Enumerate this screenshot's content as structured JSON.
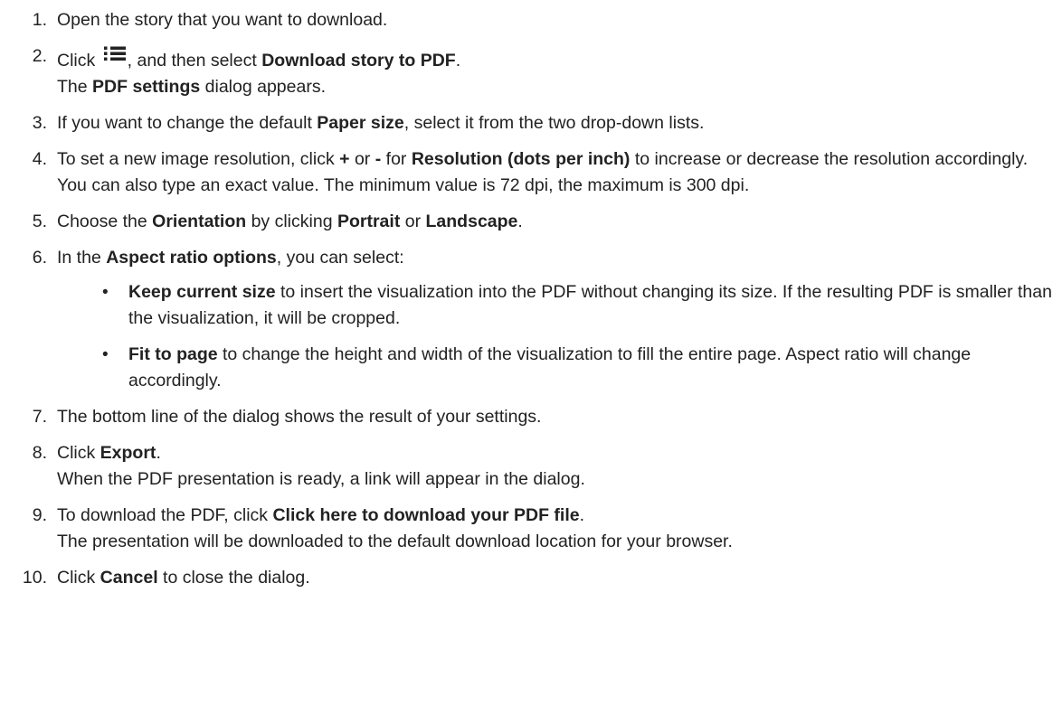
{
  "steps": [
    {
      "num": "1.",
      "parts": [
        {
          "t": "Open the story that you want to download."
        }
      ]
    },
    {
      "num": "2.",
      "parts": [
        {
          "t": "Click "
        },
        {
          "icon": "menu-list-icon"
        },
        {
          "t": ", and then select "
        },
        {
          "t": "Download story to PDF",
          "b": true
        },
        {
          "t": "."
        },
        {
          "br": true
        },
        {
          "t": "The "
        },
        {
          "t": "PDF settings",
          "b": true
        },
        {
          "t": " dialog appears."
        }
      ]
    },
    {
      "num": "3.",
      "parts": [
        {
          "t": "If you want to change the default "
        },
        {
          "t": "Paper size",
          "b": true
        },
        {
          "t": ", select it from the two drop-down lists."
        }
      ]
    },
    {
      "num": "4.",
      "parts": [
        {
          "t": "To set a new image resolution, click "
        },
        {
          "t": "+",
          "b": true
        },
        {
          "t": " or "
        },
        {
          "t": "-",
          "b": true
        },
        {
          "t": " for "
        },
        {
          "t": "Resolution (dots per inch)",
          "b": true
        },
        {
          "t": " to increase or decrease the resolution accordingly. You can also type an exact value. The minimum value is 72 dpi, the maximum is 300 dpi."
        }
      ]
    },
    {
      "num": "5.",
      "parts": [
        {
          "t": "Choose the "
        },
        {
          "t": "Orientation",
          "b": true
        },
        {
          "t": " by clicking "
        },
        {
          "t": "Portrait",
          "b": true
        },
        {
          "t": " or "
        },
        {
          "t": "Landscape",
          "b": true
        },
        {
          "t": "."
        }
      ]
    },
    {
      "num": "6.",
      "parts": [
        {
          "t": "In the "
        },
        {
          "t": "Aspect ratio options",
          "b": true
        },
        {
          "t": ", you can select:"
        }
      ],
      "subitems": [
        {
          "bullet": "•",
          "parts": [
            {
              "t": "Keep current size",
              "b": true
            },
            {
              "t": " to insert the visualization into the PDF without changing its size. If the resulting PDF is smaller than the visualization, it will be cropped."
            }
          ]
        },
        {
          "bullet": "•",
          "parts": [
            {
              "t": "Fit to page",
              "b": true
            },
            {
              "t": " to change the height and width of the visualization to fill the entire page. Aspect ratio will change accordingly."
            }
          ]
        }
      ]
    },
    {
      "num": "7.",
      "parts": [
        {
          "t": "The bottom line of the dialog shows the result of your settings."
        }
      ]
    },
    {
      "num": "8.",
      "parts": [
        {
          "t": "Click "
        },
        {
          "t": "Export",
          "b": true
        },
        {
          "t": "."
        },
        {
          "br": true
        },
        {
          "t": "When the PDF presentation is ready, a link will appear in the dialog."
        }
      ]
    },
    {
      "num": "9.",
      "parts": [
        {
          "t": "To download the PDF, click "
        },
        {
          "t": "Click here to download your PDF file",
          "b": true
        },
        {
          "t": "."
        },
        {
          "br": true
        },
        {
          "t": "The presentation will be downloaded to the default download location for your browser."
        }
      ]
    },
    {
      "num": "10.",
      "parts": [
        {
          "t": "Click "
        },
        {
          "t": "Cancel",
          "b": true
        },
        {
          "t": " to close the dialog."
        }
      ]
    }
  ]
}
